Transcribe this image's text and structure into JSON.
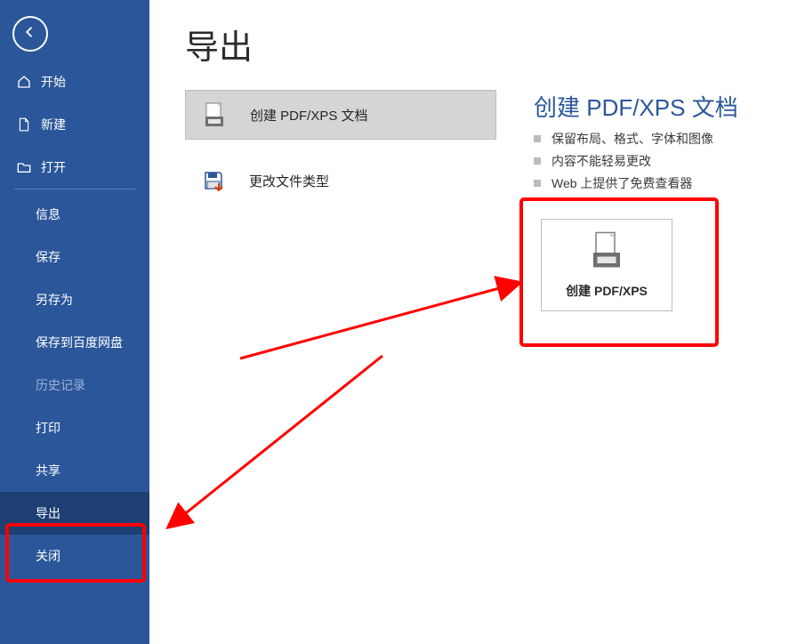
{
  "sidebar": {
    "items1": [
      {
        "label": "开始"
      },
      {
        "label": "新建"
      },
      {
        "label": "打开"
      }
    ],
    "items2": [
      {
        "label": "信息"
      },
      {
        "label": "保存"
      },
      {
        "label": "另存为"
      },
      {
        "label": "保存到百度网盘"
      },
      {
        "label": "历史记录",
        "disabled": true
      },
      {
        "label": "打印"
      },
      {
        "label": "共享"
      },
      {
        "label": "导出",
        "selected": true
      },
      {
        "label": "关闭"
      }
    ]
  },
  "content": {
    "title": "导出",
    "options": [
      {
        "label": "创建 PDF/XPS 文档",
        "selected": true,
        "icon": "pdf"
      },
      {
        "label": "更改文件类型",
        "icon": "disk"
      }
    ]
  },
  "right": {
    "title": "创建 PDF/XPS 文档",
    "bullets": [
      "保留布局、格式、字体和图像",
      "内容不能轻易更改",
      "Web 上提供了免费查看器"
    ],
    "button": "创建 PDF/XPS"
  }
}
